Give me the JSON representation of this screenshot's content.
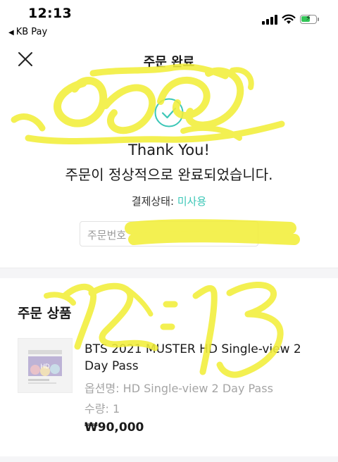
{
  "status_bar": {
    "time": "12:13",
    "back_app": "KB Pay",
    "back_icon": "back-triangle-icon",
    "battery_state": "charging"
  },
  "header": {
    "title": "주문 완료",
    "close_icon": "close-icon"
  },
  "confirmation": {
    "icon": "check-circle-icon",
    "accent_color": "#3cc7b7",
    "thank_you": "Thank You!",
    "message": "주문이 정상적으로 완료되었습니다.",
    "payment_status_label": "결제상태:",
    "payment_status_value": "미사용",
    "order_number_label": "주문번호"
  },
  "order_items": {
    "section_title": "주문 상품",
    "items": [
      {
        "name": "BTS 2021 MUSTER HD Single-view 2 Day Pass",
        "option_label": "옵션명:",
        "option_value": "HD Single-view 2 Day Pass",
        "qty_label": "수량:",
        "qty_value": "1",
        "price": "₩90,000",
        "thumb_text": "HD"
      }
    ]
  },
  "colors": {
    "accent": "#3cc7b7",
    "scribble": "#f2ee3a"
  }
}
